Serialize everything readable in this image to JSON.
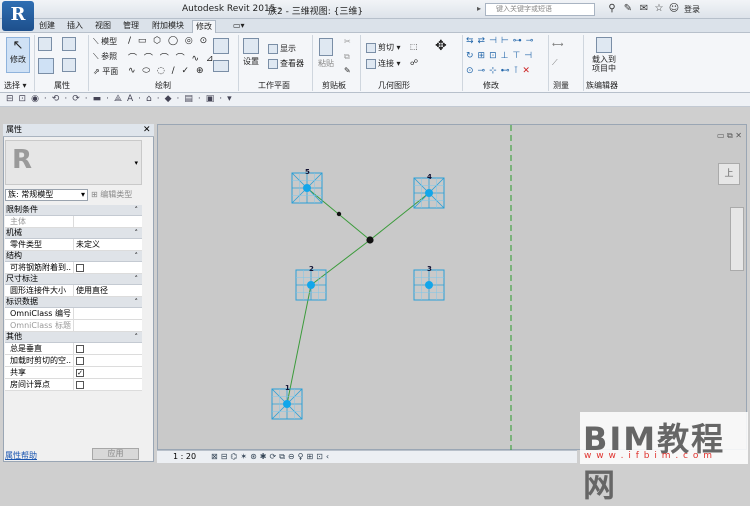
{
  "title_bar": {
    "app_title": "Autodesk Revit 2015 -",
    "separator": "",
    "doc_title": "族2 - 三维视图: {三维}",
    "search_placeholder": "键入关键字或短语",
    "login": "登录",
    "logo": "R"
  },
  "tabs": [
    "创建",
    "插入",
    "视图",
    "管理",
    "附加模块",
    "修改"
  ],
  "active_tab": "修改",
  "ribbon": {
    "modify": "修改",
    "select_label": "选择 ▾",
    "properties_label": "属性",
    "geometry": {
      "items": [
        "模型",
        "参照",
        "平面"
      ],
      "label": "绘制"
    },
    "workplane": {
      "set": "设置",
      "show": "显示",
      "viewer": "查看器",
      "label": "工作平面"
    },
    "clipboard": {
      "paste": "粘贴",
      "label": "剪贴板"
    },
    "geometry2": {
      "cut": "剪切",
      "join": "连接",
      "label": "几何图形"
    },
    "modify_panel": {
      "label": "修改"
    },
    "measure": {
      "label": "测量"
    },
    "family_editor": {
      "load": "载入到项目中",
      "label": "族编辑器"
    }
  },
  "properties": {
    "header": "属性",
    "family_select": "族: 常规模型",
    "edit_type": "编辑类型",
    "groups": [
      {
        "name": "限制条件",
        "rows": [
          {
            "k": "主体",
            "v": "",
            "dim": true
          }
        ]
      },
      {
        "name": "机械",
        "rows": [
          {
            "k": "零件类型",
            "v": "未定义"
          }
        ]
      },
      {
        "name": "结构",
        "rows": [
          {
            "k": "可将钢筋附着到...",
            "v": "",
            "cb": ""
          }
        ]
      },
      {
        "name": "尺寸标注",
        "rows": [
          {
            "k": "圆形连接件大小",
            "v": "使用直径"
          }
        ]
      },
      {
        "name": "标识数据",
        "rows": [
          {
            "k": "OmniClass 编号",
            "v": ""
          },
          {
            "k": "OmniClass 标题",
            "v": "",
            "dim": true
          }
        ]
      },
      {
        "name": "其他",
        "rows": [
          {
            "k": "总是垂直",
            "v": "",
            "cb": ""
          },
          {
            "k": "加载时剪切的空...",
            "v": "",
            "cb": ""
          },
          {
            "k": "共享",
            "v": "",
            "cb": "✓"
          },
          {
            "k": "房间计算点",
            "v": "",
            "cb": ""
          }
        ]
      }
    ],
    "help": "属性帮助",
    "apply": "应用"
  },
  "canvas": {
    "nodes": [
      {
        "label": "1"
      },
      {
        "label": "2"
      },
      {
        "label": "3"
      },
      {
        "label": "4"
      },
      {
        "label": "5"
      }
    ]
  },
  "status": {
    "scale": "1 : 20"
  },
  "watermark": {
    "brand": "BIM教程网",
    "url": "w w w . i f b i m . c o m"
  }
}
